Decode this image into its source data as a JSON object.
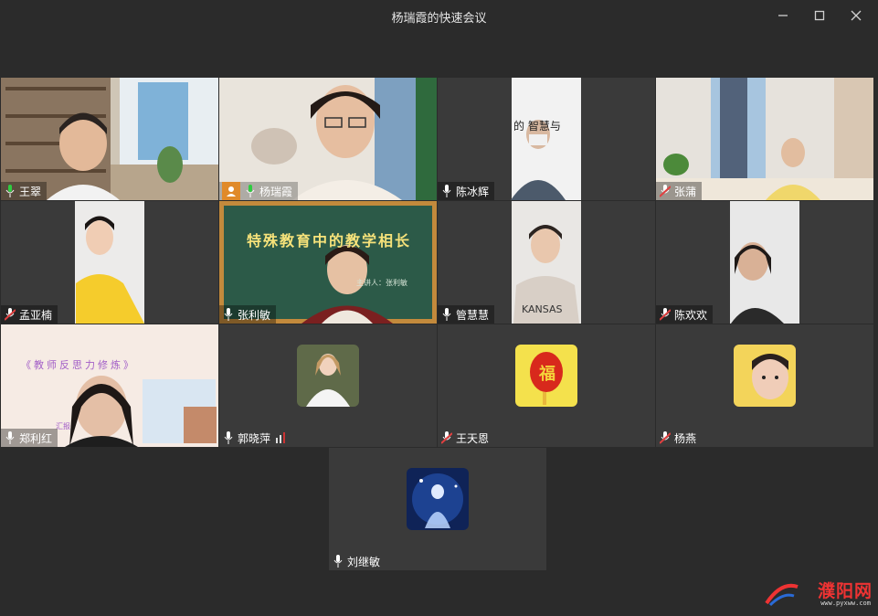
{
  "window": {
    "title": "杨瑞霞的快速会议",
    "minimize_icon": "minimize-icon",
    "maximize_icon": "maximize-icon",
    "close_icon": "close-icon"
  },
  "participants": [
    {
      "name": "王翠",
      "mic": "on",
      "video": "office-room"
    },
    {
      "name": "杨瑞霞",
      "mic": "on",
      "host": true,
      "speaking": true,
      "video": "woman-sweater"
    },
    {
      "name": "陈冰辉",
      "mic": "on",
      "video": "man-mask-slide",
      "slide_text": "的 智慧与"
    },
    {
      "name": "张蒲",
      "mic": "muted",
      "video": "room-window"
    },
    {
      "name": "孟亚楠",
      "mic": "muted",
      "video": "woman-yellow"
    },
    {
      "name": "张利敏",
      "mic": "on",
      "video": "blackboard",
      "board_text": "特殊教育中的教学相长",
      "board_sub": "主讲人：张利敏"
    },
    {
      "name": "管慧慧",
      "mic": "on",
      "video": "woman-kansas"
    },
    {
      "name": "陈欢欢",
      "mic": "muted",
      "video": "woman-glasses"
    },
    {
      "name": "郑利红",
      "mic": "on",
      "video": "slide-woman",
      "slide_text": "《教师反思力修炼》",
      "slide_tag": "汇报"
    },
    {
      "name": "郭晓萍",
      "mic": "on",
      "video": "avatar-girl-white",
      "signal": "bars"
    },
    {
      "name": "王天恩",
      "mic": "muted",
      "video": "avatar-fu-lantern",
      "avatar_text": "福"
    },
    {
      "name": "杨燕",
      "mic": "muted",
      "video": "avatar-child"
    },
    {
      "name": "刘继敏",
      "mic": "on",
      "video": "avatar-blue-figure"
    }
  ],
  "watermark": {
    "text": "濮阳网",
    "url": "www.pyxww.com"
  },
  "colors": {
    "background": "#2b2b2b",
    "tile": "#3a3a3a",
    "active_border": "#3fcf5f",
    "muted": "#e04040",
    "host_badge": "#e08a2a"
  }
}
